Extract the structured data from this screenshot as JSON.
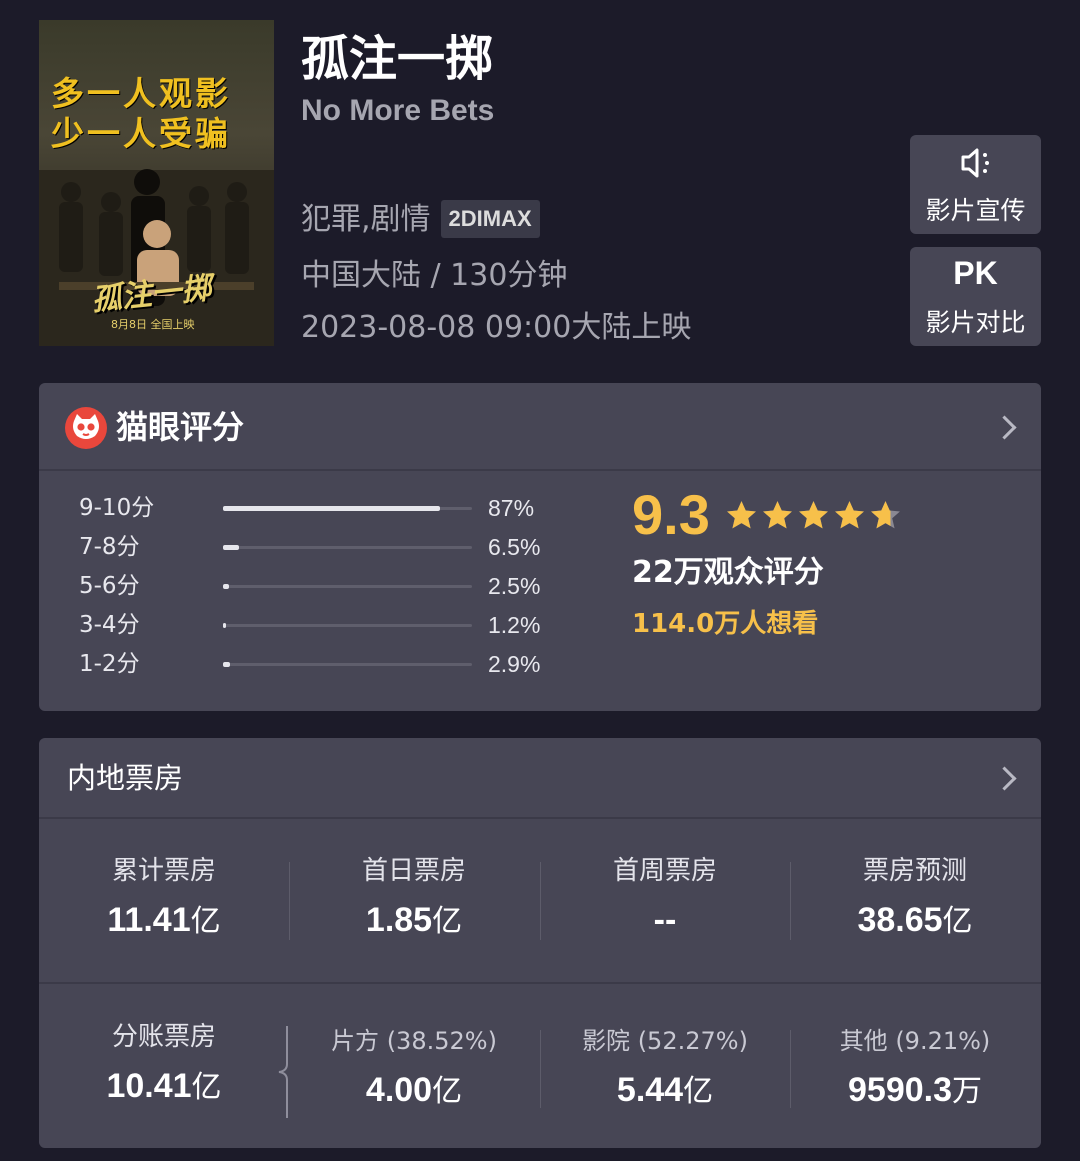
{
  "movie": {
    "title_cn": "孤注一掷",
    "title_en": "No More Bets",
    "genres": "犯罪,剧情",
    "format_tag": "2DIMAX",
    "origin_duration": "中国大陆 / 130分钟",
    "release": "2023-08-08 09:00大陆上映",
    "poster": {
      "tagline_1": "多一人观影",
      "tagline_2": "少一人受骗",
      "logo": "孤注一掷",
      "date": "8月8日 全国上映"
    }
  },
  "side_buttons": {
    "promo_label": "影片宣传",
    "promo_icon": "speaker-icon",
    "pk_text": "PK",
    "pk_label": "影片对比"
  },
  "rating": {
    "brand": "猫眼评分",
    "score": "9.3",
    "stars": 4.65,
    "voters": "22万观众评分",
    "wish": "114.0万人想看",
    "distribution": [
      {
        "label": "9-10分",
        "pct": "87%",
        "value": 0.87
      },
      {
        "label": "7-8分",
        "pct": "6.5%",
        "value": 0.065
      },
      {
        "label": "5-6分",
        "pct": "2.5%",
        "value": 0.025
      },
      {
        "label": "3-4分",
        "pct": "1.2%",
        "value": 0.012
      },
      {
        "label": "1-2分",
        "pct": "2.9%",
        "value": 0.029
      }
    ]
  },
  "box_office": {
    "title": "内地票房",
    "top": [
      {
        "label": "累计票房",
        "value": "11.41",
        "unit": "亿"
      },
      {
        "label": "首日票房",
        "value": "1.85",
        "unit": "亿"
      },
      {
        "label": "首周票房",
        "value": "--",
        "unit": ""
      },
      {
        "label": "票房预测",
        "value": "38.65",
        "unit": "亿"
      }
    ],
    "bottom": [
      {
        "label": "分账票房",
        "value": "10.41",
        "unit": "亿"
      },
      {
        "label": "片方 (38.52%)",
        "value": "4.00",
        "unit": "亿"
      },
      {
        "label": "影院 (52.27%)",
        "value": "5.44",
        "unit": "亿"
      },
      {
        "label": "其他 (9.21%)",
        "value": "9590.3",
        "unit": "万"
      }
    ]
  },
  "colors": {
    "background": "#1c1b29",
    "card": "#474655",
    "accent_gold": "#f7c04a",
    "brand_red": "#e9473c"
  }
}
